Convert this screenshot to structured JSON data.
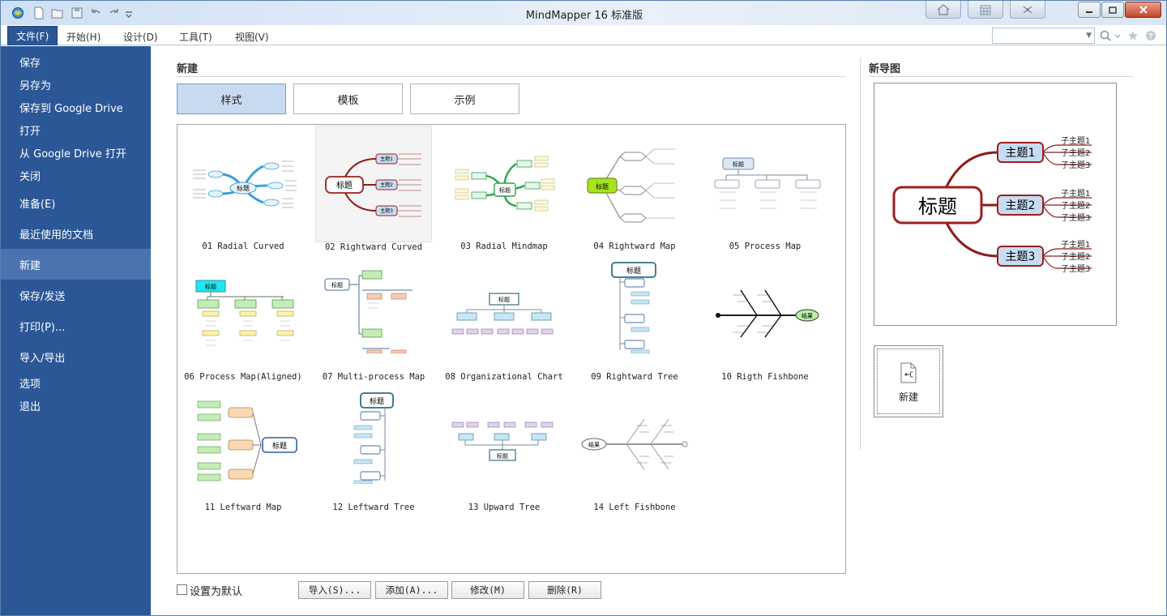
{
  "window": {
    "title": "MindMapper 16 标准版"
  },
  "menu": {
    "file": "文件(F)",
    "items": [
      "开始(H)",
      "设计(D)",
      "工具(T)",
      "视图(V)"
    ]
  },
  "sidebar": {
    "items": [
      "保存",
      "另存为",
      "保存到 Google Drive",
      "打开",
      "从 Google Drive 打开",
      "关闭",
      "准备(E)",
      "最近使用的文档",
      "新建",
      "保存/发送",
      "打印(P)...",
      "导入/导出",
      "选项",
      "退出"
    ],
    "active": "新建"
  },
  "main": {
    "section_title": "新建",
    "tabs": [
      "样式",
      "模板",
      "示例"
    ],
    "selected_tab": "样式"
  },
  "gallery": {
    "items": [
      "01 Radial Curved",
      "02 Rightward Curved",
      "03 Radial Mindmap",
      "04 Rightward Map",
      "05 Process Map",
      "06 Process Map(Aligned)",
      "07 Multi-process Map",
      "08 Organizational Chart",
      "09 Rightward Tree",
      "10 Rigth Fishbone",
      "11 Leftward Map",
      "12 Leftward Tree",
      "13 Upward Tree",
      "14 Left Fishbone"
    ],
    "selected": "02 Rightward Curved"
  },
  "thumb_text": {
    "root": "标题",
    "topics": [
      "主题1",
      "主题2",
      "主题3"
    ],
    "sub": "子主题",
    "result": "结果",
    "sub_topics": [
      "子主题1",
      "子主题2",
      "子主题3"
    ]
  },
  "bottom": {
    "default_label": "设置为默认",
    "import": "导入(S)...",
    "add": "添加(A)...",
    "modify": "修改(M)",
    "delete": "删除(R)"
  },
  "preview": {
    "title": "新导图",
    "root": "标题",
    "topics": [
      "主题1",
      "主题2",
      "主题3"
    ],
    "subtopics": [
      "子主题1",
      "子主题2",
      "子主题3"
    ],
    "new_label": "新建"
  },
  "colors": {
    "sidebar_bg": "#2b5797",
    "sidebar_active": "#4a73b0",
    "tab_selected": "#c8daf0",
    "root_border": "#9c1f1f",
    "topic_fill": "#c6dcf2",
    "branch": "#8e1a1a"
  }
}
